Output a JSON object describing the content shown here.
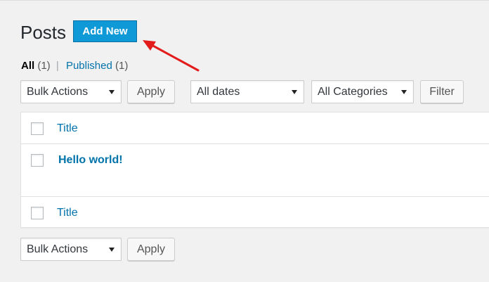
{
  "page": {
    "title": "Posts",
    "add_new_label": "Add New"
  },
  "subsubsub": {
    "all_label": "All",
    "all_count": "(1)",
    "separator": "|",
    "published_label": "Published",
    "published_count": "(1)"
  },
  "tablenav_top": {
    "bulk_actions": "Bulk Actions",
    "apply_label": "Apply",
    "dates_filter": "All dates",
    "categories_filter": "All Categories",
    "filter_label": "Filter"
  },
  "table": {
    "header_title": "Title",
    "footer_title": "Title",
    "rows": [
      {
        "title": "Hello world!"
      }
    ]
  },
  "tablenav_bottom": {
    "bulk_actions": "Bulk Actions",
    "apply_label": "Apply"
  },
  "annotation": {
    "arrow_color": "#e31b1b"
  },
  "colors": {
    "accent": "#0073aa",
    "primary_button": "#0f9ad7"
  }
}
